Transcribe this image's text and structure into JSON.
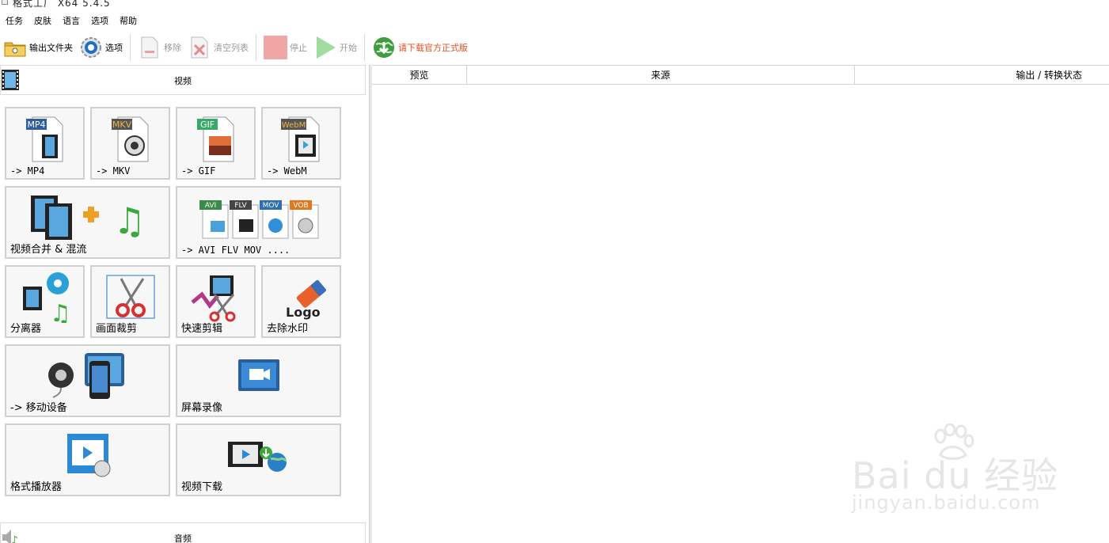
{
  "window": {
    "title": "格式工厂 X64 5.4.5"
  },
  "menu": [
    "任务",
    "皮肤",
    "语言",
    "选项",
    "帮助"
  ],
  "toolbar": {
    "output_folder": "输出文件夹",
    "options": "选项",
    "remove": "移除",
    "clear_list": "清空列表",
    "stop": "停止",
    "start": "开始",
    "download_official": "请下载官方正式版"
  },
  "left_panel": {
    "video_category": "视频",
    "audio_category": "音频",
    "tiles": {
      "mp4": {
        "badge": "MP4",
        "label": "-> MP4"
      },
      "mkv": {
        "badge": "MKV",
        "label": "-> MKV"
      },
      "gif": {
        "badge": "GIF",
        "label": "-> GIF"
      },
      "webm": {
        "badge": "WebM",
        "label": "-> WebM"
      },
      "merge": {
        "label": "视频合并 & 混流"
      },
      "others": {
        "badges": [
          "AVI",
          "FLV",
          "MOV",
          "VOB"
        ],
        "label": "-> AVI FLV MOV ...."
      },
      "splitter": {
        "label": "分离器"
      },
      "crop": {
        "label": "画面裁剪"
      },
      "quick_clip": {
        "label": "快速剪辑"
      },
      "remove_watermark": {
        "logo_text": "Logo",
        "label": "去除水印"
      },
      "mobile": {
        "label": "-> 移动设备"
      },
      "screen_record": {
        "label": "屏幕录像"
      },
      "player": {
        "label": "格式播放器"
      },
      "video_download": {
        "label": "视频下载"
      }
    }
  },
  "task_list": {
    "columns": [
      "预览",
      "来源",
      "输出 / 转换状态"
    ]
  },
  "watermark": {
    "main": "Bai du 经验",
    "sub": "jingyan.baidu.com"
  },
  "colors": {
    "mp4_badge": "#2f5f9e",
    "mkv_badge": "#555555",
    "gif_badge": "#3aa86a",
    "webm_badge": "#555555",
    "promo_text": "#e5511b",
    "disabled_text": "#9a9a9a",
    "tile_border": "#d0d0d0",
    "tile_bg": "#f7f7f7"
  }
}
